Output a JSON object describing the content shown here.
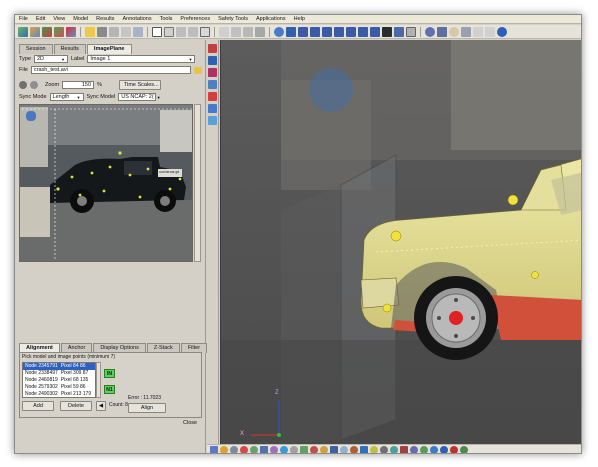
{
  "menu": [
    "File",
    "Edit",
    "View",
    "Model",
    "Results",
    "Annotations",
    "Tools",
    "Preferences",
    "Safety Tools",
    "Applications",
    "Help"
  ],
  "top_tabs": [
    "Session",
    "Results",
    "ImagePlane"
  ],
  "type_label": "Type",
  "type_value": "2D",
  "label_label": "Label",
  "label_value": "Image 1",
  "file_label": "File",
  "file_value": "crash_test.avi",
  "zoom_label": "Zoom",
  "zoom_value": "150",
  "zoom_unit": "%",
  "time_scales_label": "Time Scales...",
  "sync_mode_label": "Sync Mode",
  "sync_mode_value": "Length",
  "sync_model_label": "Sync Model",
  "sync_model_value": "US NCAP: 2(",
  "align_tabs": [
    "Alignment",
    "Anchor",
    "Display Options",
    "Z-Stack",
    "Filter"
  ],
  "pick_hint": "Pick model and image points (minimum 7)",
  "nodes": [
    {
      "node": "Node 2345791",
      "pixel": "Pixel 84 86"
    },
    {
      "node": "Node 2338497",
      "pixel": "Pixel 309 87"
    },
    {
      "node": "Node 2460819",
      "pixel": "Pixel 68 135"
    },
    {
      "node": "Node 2579302",
      "pixel": "Pixel 59 86"
    },
    {
      "node": "Node 2490302",
      "pixel": "Pixel 213 179"
    }
  ],
  "in_label": "IN",
  "n1_label": "N1",
  "error_text": "Error : 11.7023",
  "count_text": "Count: 8",
  "add_label": "Add",
  "delete_label": "Delete",
  "align_label": "Align",
  "close_label": "Close",
  "car_label": "ouchercar.gd",
  "axis": {
    "x": "X",
    "z": "Z"
  }
}
